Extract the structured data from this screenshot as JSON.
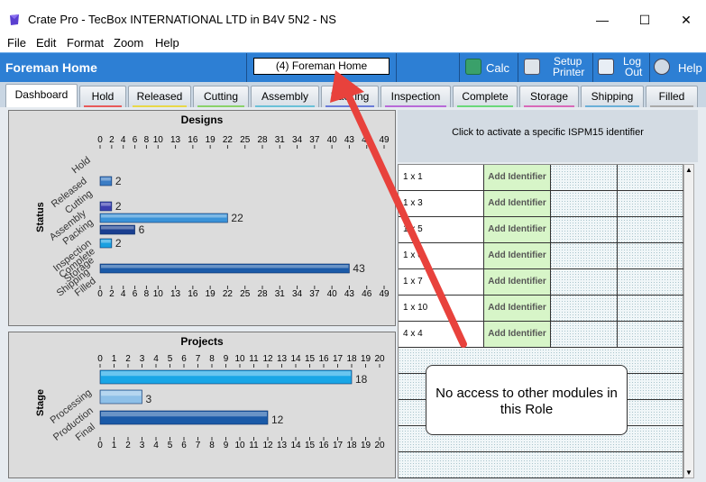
{
  "window": {
    "title": "Crate Pro - TecBox INTERNATIONAL LTD in B4V 5N2 - NS",
    "minimize": "—",
    "maximize": "☐",
    "close": "✕"
  },
  "menu": [
    "File",
    "Edit",
    "Format",
    "Zoom",
    "Help"
  ],
  "header": {
    "title": "Foreman Home",
    "role": "(4) Foreman Home",
    "calc_label": "Calc",
    "setup_printer_line1": "Setup",
    "setup_printer_line2": "Printer",
    "logout_line1": "Log",
    "logout_line2": "Out",
    "help_label": "Help"
  },
  "tabs": [
    {
      "label": "Dashboard",
      "color": "#ffffff"
    },
    {
      "label": "Hold",
      "color": "#e85a5a"
    },
    {
      "label": "Released",
      "color": "#e8d84a"
    },
    {
      "label": "Cutting",
      "color": "#8ad26a"
    },
    {
      "label": "Assembly",
      "color": "#6ac1d8"
    },
    {
      "label": "Packing",
      "color": "#6a7bd8"
    },
    {
      "label": "Inspection",
      "color": "#b86ad8"
    },
    {
      "label": "Complete",
      "color": "#6ad87a"
    },
    {
      "label": "Storage",
      "color": "#d86ab8"
    },
    {
      "label": "Shipping",
      "color": "#6ab0d8"
    },
    {
      "label": "Filled",
      "color": "#aaaaaa"
    }
  ],
  "chart_data": [
    {
      "type": "bar",
      "orientation": "horizontal",
      "title": "Designs",
      "ylabel": "Status",
      "categories": [
        "Hold",
        "Released",
        "Cutting",
        "Assembly",
        "Packing",
        "Inspection",
        "Complete",
        "Storage",
        "Shipping",
        "Filled"
      ],
      "values": [
        0,
        0,
        2,
        0,
        2,
        22,
        6,
        2,
        0,
        43
      ],
      "xticks": [
        0,
        2,
        4,
        6,
        8,
        10,
        13,
        16,
        19,
        22,
        25,
        28,
        31,
        34,
        37,
        40,
        43,
        46,
        49
      ],
      "xlim": [
        0,
        49
      ],
      "colors": [
        "#3a7cc4",
        "#3a7cc4",
        "#3a7cc4",
        "#3a7cc4",
        "#3d3fb0",
        "#3a93d8",
        "#1a3f90",
        "#1aa0e0",
        "#3a7cc4",
        "#1a5aa8"
      ]
    },
    {
      "type": "bar",
      "orientation": "horizontal",
      "title": "Projects",
      "ylabel": "Stage",
      "categories": [
        "Processing",
        "Production",
        "Final"
      ],
      "values": [
        18,
        3,
        12
      ],
      "xticks": [
        0,
        1,
        2,
        3,
        4,
        5,
        6,
        7,
        8,
        9,
        10,
        11,
        12,
        13,
        14,
        15,
        16,
        17,
        18,
        19,
        20
      ],
      "xlim": [
        0,
        20
      ],
      "colors": [
        "#19a6e6",
        "#8ec0e8",
        "#1a5aa8"
      ]
    }
  ],
  "identifiers": {
    "instruction": "Click to activate a specific ISPM15 identifier",
    "add_label": "Add Identifier",
    "rows": [
      "1 x 1",
      "1 x 3",
      "1 x 5",
      "1 x 6",
      "1 x 7",
      "1 x 10",
      "4 x 4"
    ]
  },
  "callout": {
    "text": "No access to other modules in this Role"
  }
}
